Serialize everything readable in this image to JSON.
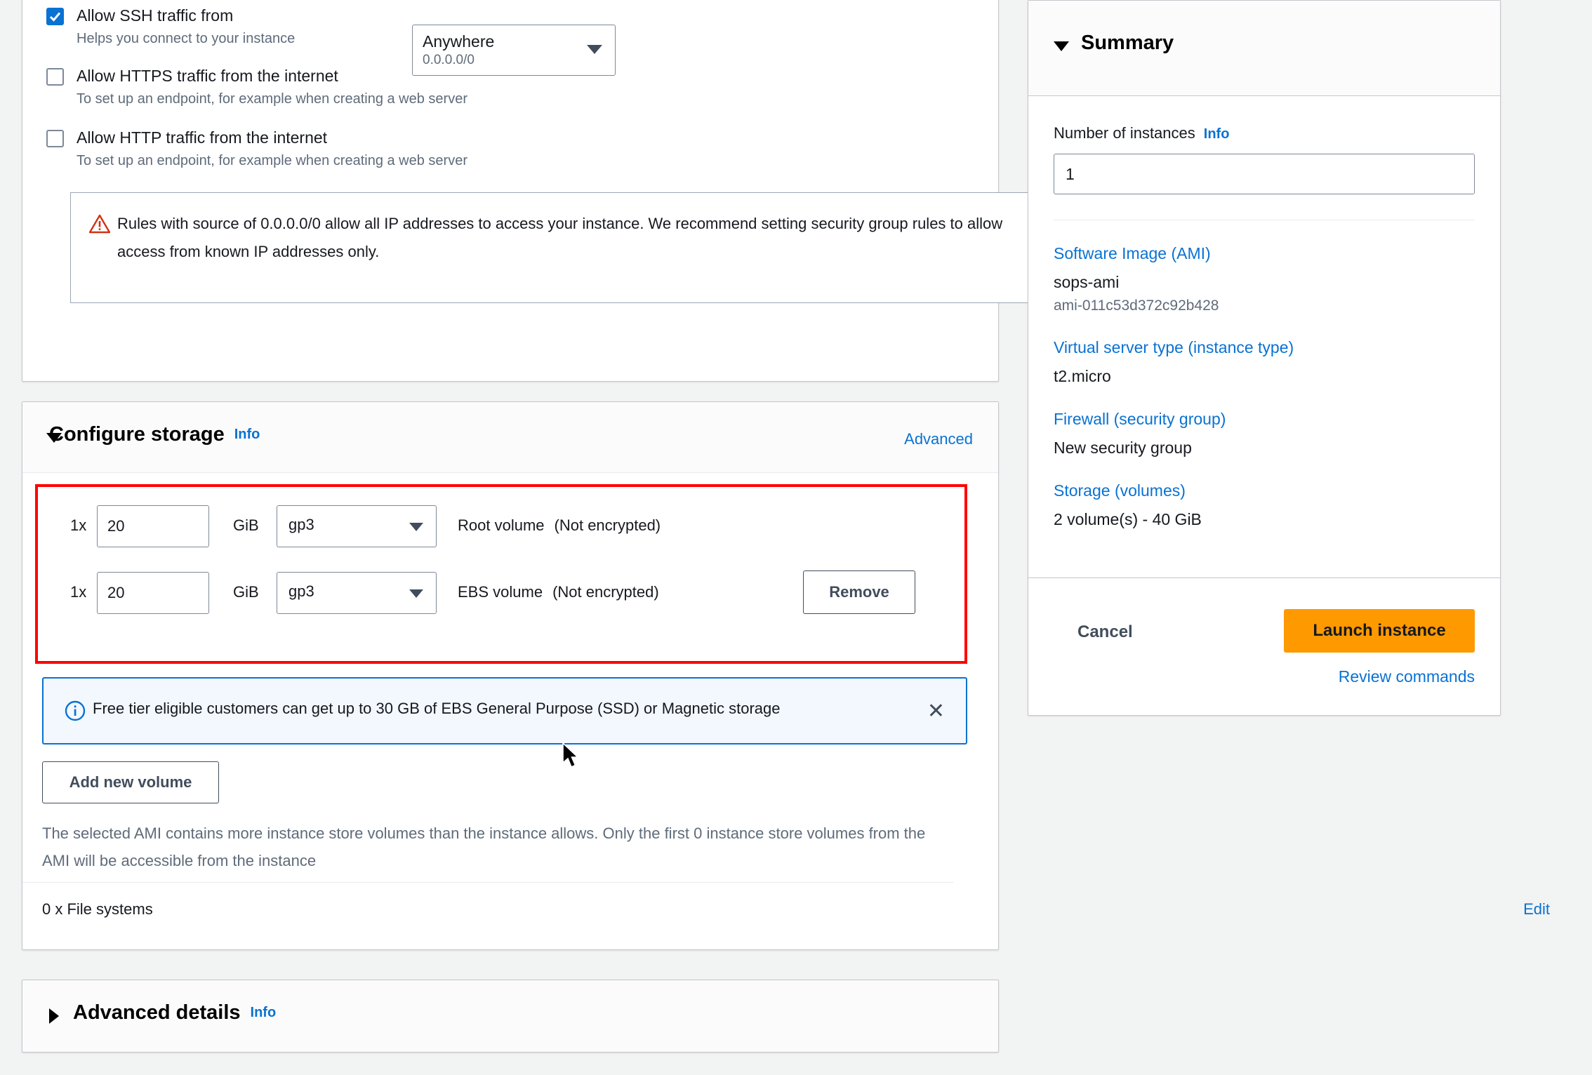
{
  "security_group": {
    "rules": [
      {
        "label": "Allow SSH traffic from",
        "description": "Helps you connect to your instance",
        "checked": true
      },
      {
        "label": "Allow HTTPS traffic from the internet",
        "description": "To set up an endpoint, for example when creating a web server",
        "checked": false
      },
      {
        "label": "Allow HTTP traffic from the internet",
        "description": "To set up an endpoint, for example when creating a web server",
        "checked": false
      }
    ],
    "ssh_source": {
      "value": "Anywhere",
      "cidr": "0.0.0.0/0"
    },
    "warning": {
      "icon": "warning-triangle-icon",
      "text": "Rules with source of 0.0.0.0/0 allow all IP addresses to access your instance. We recommend setting security group rules to allow access from known IP addresses only.",
      "dismiss_label": "✕"
    }
  },
  "storage": {
    "section_title": "Configure storage",
    "info_label": "Info",
    "advanced_label": "Advanced",
    "gib_label": "GiB",
    "volumes": [
      {
        "multiplier": "1x",
        "size": "20",
        "unit": "GiB",
        "type": "gp3",
        "name": "Root volume",
        "encryption": "(Not encrypted)",
        "remove_label": null
      },
      {
        "multiplier": "1x",
        "size": "20",
        "unit": "GiB",
        "type": "gp3",
        "name": "EBS volume",
        "encryption": "(Not encrypted)",
        "remove_label": "Remove"
      }
    ],
    "free_tier_notice": {
      "icon": "info-circle-icon",
      "text": "Free tier eligible customers can get up to 30 GB of EBS General Purpose (SSD) or Magnetic storage",
      "dismiss_label": "✕"
    },
    "add_volume_label": "Add new volume",
    "ami_note": "The selected AMI contains more instance store volumes than the instance allows. Only the first 0 instance store volumes from the AMI will be accessible from the instance",
    "file_systems_label": "0 x File systems",
    "file_systems_edit_label": "Edit"
  },
  "advanced_details": {
    "title": "Advanced details",
    "info_label": "Info",
    "expanded": false
  },
  "summary": {
    "title": "Summary",
    "number_of_instances": {
      "label": "Number of instances",
      "info_label": "Info",
      "value": "1"
    },
    "items": [
      {
        "link": "Software Image (AMI)",
        "value": "sops-ami",
        "sub": "ami-011c53d372c92b428"
      },
      {
        "link": "Virtual server type (instance type)",
        "value": "t2.micro",
        "sub": null
      },
      {
        "link": "Firewall (security group)",
        "value": "New security group",
        "sub": null
      },
      {
        "link": "Storage (volumes)",
        "value": "2 volume(s) - 40 GiB",
        "sub": null
      }
    ],
    "cancel_label": "Cancel",
    "launch_label": "Launch instance",
    "review_label": "Review commands"
  },
  "colors": {
    "accent_link": "#0972d3",
    "launch_button": "#ff9900",
    "highlight_box": "#ff0000",
    "warning_icon": "#d13212"
  }
}
